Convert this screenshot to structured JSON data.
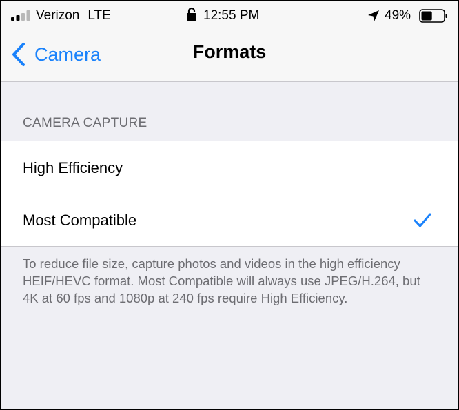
{
  "status_bar": {
    "carrier": "Verizon",
    "network": "LTE",
    "time": "12:55 PM",
    "battery_percent": "49%",
    "battery_level": 0.49,
    "signal_bars_filled": 2,
    "signal_bars_total": 4,
    "icons": [
      "signal-icon",
      "lock-icon",
      "location-icon",
      "battery-icon"
    ]
  },
  "nav": {
    "back_label": "Camera",
    "title": "Formats",
    "accent_color": "#1a82fb"
  },
  "section": {
    "header": "CAMERA CAPTURE",
    "options": [
      {
        "label": "High Efficiency",
        "selected": false
      },
      {
        "label": "Most Compatible",
        "selected": true
      }
    ],
    "footer": "To reduce file size, capture photos and videos in the high efficiency HEIF/HEVC format. Most Compatible will always use JPEG/H.264, but 4K at 60 fps and 1080p at 240 fps require High Efficiency."
  }
}
